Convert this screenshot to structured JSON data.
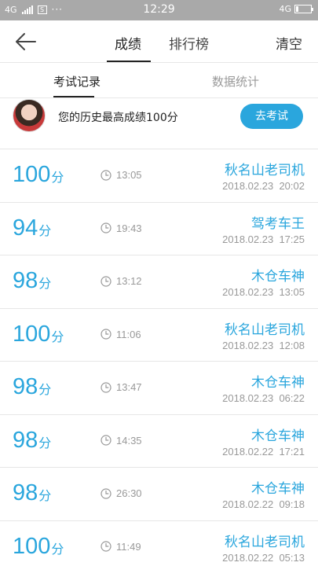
{
  "status_bar": {
    "network_left": "4G",
    "sim_icon": "sim-icon",
    "dots": "···",
    "time": "12:29",
    "network_right": "4G",
    "battery_level": 0.15
  },
  "header": {
    "back_icon": "arrow-left-icon",
    "tabs": [
      {
        "label": "成绩",
        "active": true
      },
      {
        "label": "排行榜",
        "active": false
      }
    ],
    "clear_label": "清空"
  },
  "subtabs": [
    {
      "label": "考试记录",
      "active": true
    },
    {
      "label": "数据统计",
      "active": false
    }
  ],
  "best": {
    "text": "您的历史最高成绩100分",
    "button": "去考试"
  },
  "records": [
    {
      "score": "100",
      "unit": "分",
      "duration": "13:05",
      "nickname": "秋名山老司机",
      "date": "2018.02.23",
      "time": "20:02"
    },
    {
      "score": "94",
      "unit": "分",
      "duration": "19:43",
      "nickname": "驾考车王",
      "date": "2018.02.23",
      "time": "17:25"
    },
    {
      "score": "98",
      "unit": "分",
      "duration": "13:12",
      "nickname": "木仓车神",
      "date": "2018.02.23",
      "time": "13:05"
    },
    {
      "score": "100",
      "unit": "分",
      "duration": "11:06",
      "nickname": "秋名山老司机",
      "date": "2018.02.23",
      "time": "12:08"
    },
    {
      "score": "98",
      "unit": "分",
      "duration": "13:47",
      "nickname": "木仓车神",
      "date": "2018.02.23",
      "time": "06:22"
    },
    {
      "score": "98",
      "unit": "分",
      "duration": "14:35",
      "nickname": "木仓车神",
      "date": "2018.02.22",
      "time": "17:21"
    },
    {
      "score": "98",
      "unit": "分",
      "duration": "26:30",
      "nickname": "木仓车神",
      "date": "2018.02.22",
      "time": "09:18"
    },
    {
      "score": "100",
      "unit": "分",
      "duration": "11:49",
      "nickname": "秋名山老司机",
      "date": "2018.02.22",
      "time": "05:13"
    }
  ],
  "colors": {
    "accent": "#2aa6dd",
    "status_bar": "#a9a9a9",
    "muted": "#999999"
  }
}
